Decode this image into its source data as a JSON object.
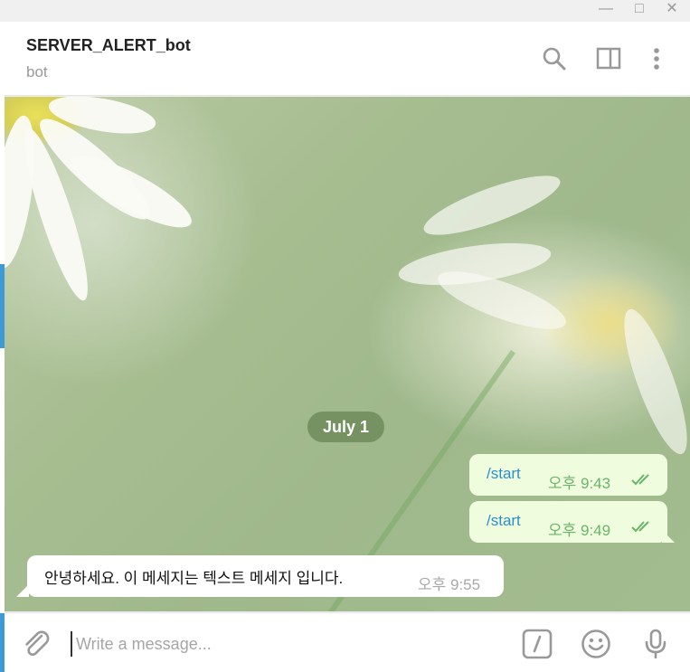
{
  "window": {
    "controls": {
      "minimize": "—",
      "maximize": "□",
      "close": "✕"
    }
  },
  "header": {
    "title": "SERVER_ALERT_bot",
    "subtitle": "bot",
    "icons": [
      "search-icon",
      "sidebar-panel-icon",
      "more-vert-icon"
    ]
  },
  "chat": {
    "date_pill": "July 1",
    "messages": [
      {
        "direction": "out",
        "text": "/start",
        "time": "오후 9:43",
        "status": "read"
      },
      {
        "direction": "out",
        "text": "/start",
        "time": "오후 9:49",
        "status": "read"
      },
      {
        "direction": "in",
        "text": "안녕하세요. 이 메세지는 텍스트 메세지 입니다.",
        "time": "오후 9:55"
      }
    ]
  },
  "composer": {
    "placeholder": "Write a message...",
    "value": "",
    "icons": [
      "attach-icon",
      "commands-icon",
      "emoji-icon",
      "microphone-icon"
    ]
  },
  "colors": {
    "accent": "#3d9ad6",
    "outgoing_bubble": "#effdde",
    "outgoing_text": "#2f8fc8",
    "outgoing_time": "#6bb46a",
    "date_pill": "#708b5b"
  }
}
